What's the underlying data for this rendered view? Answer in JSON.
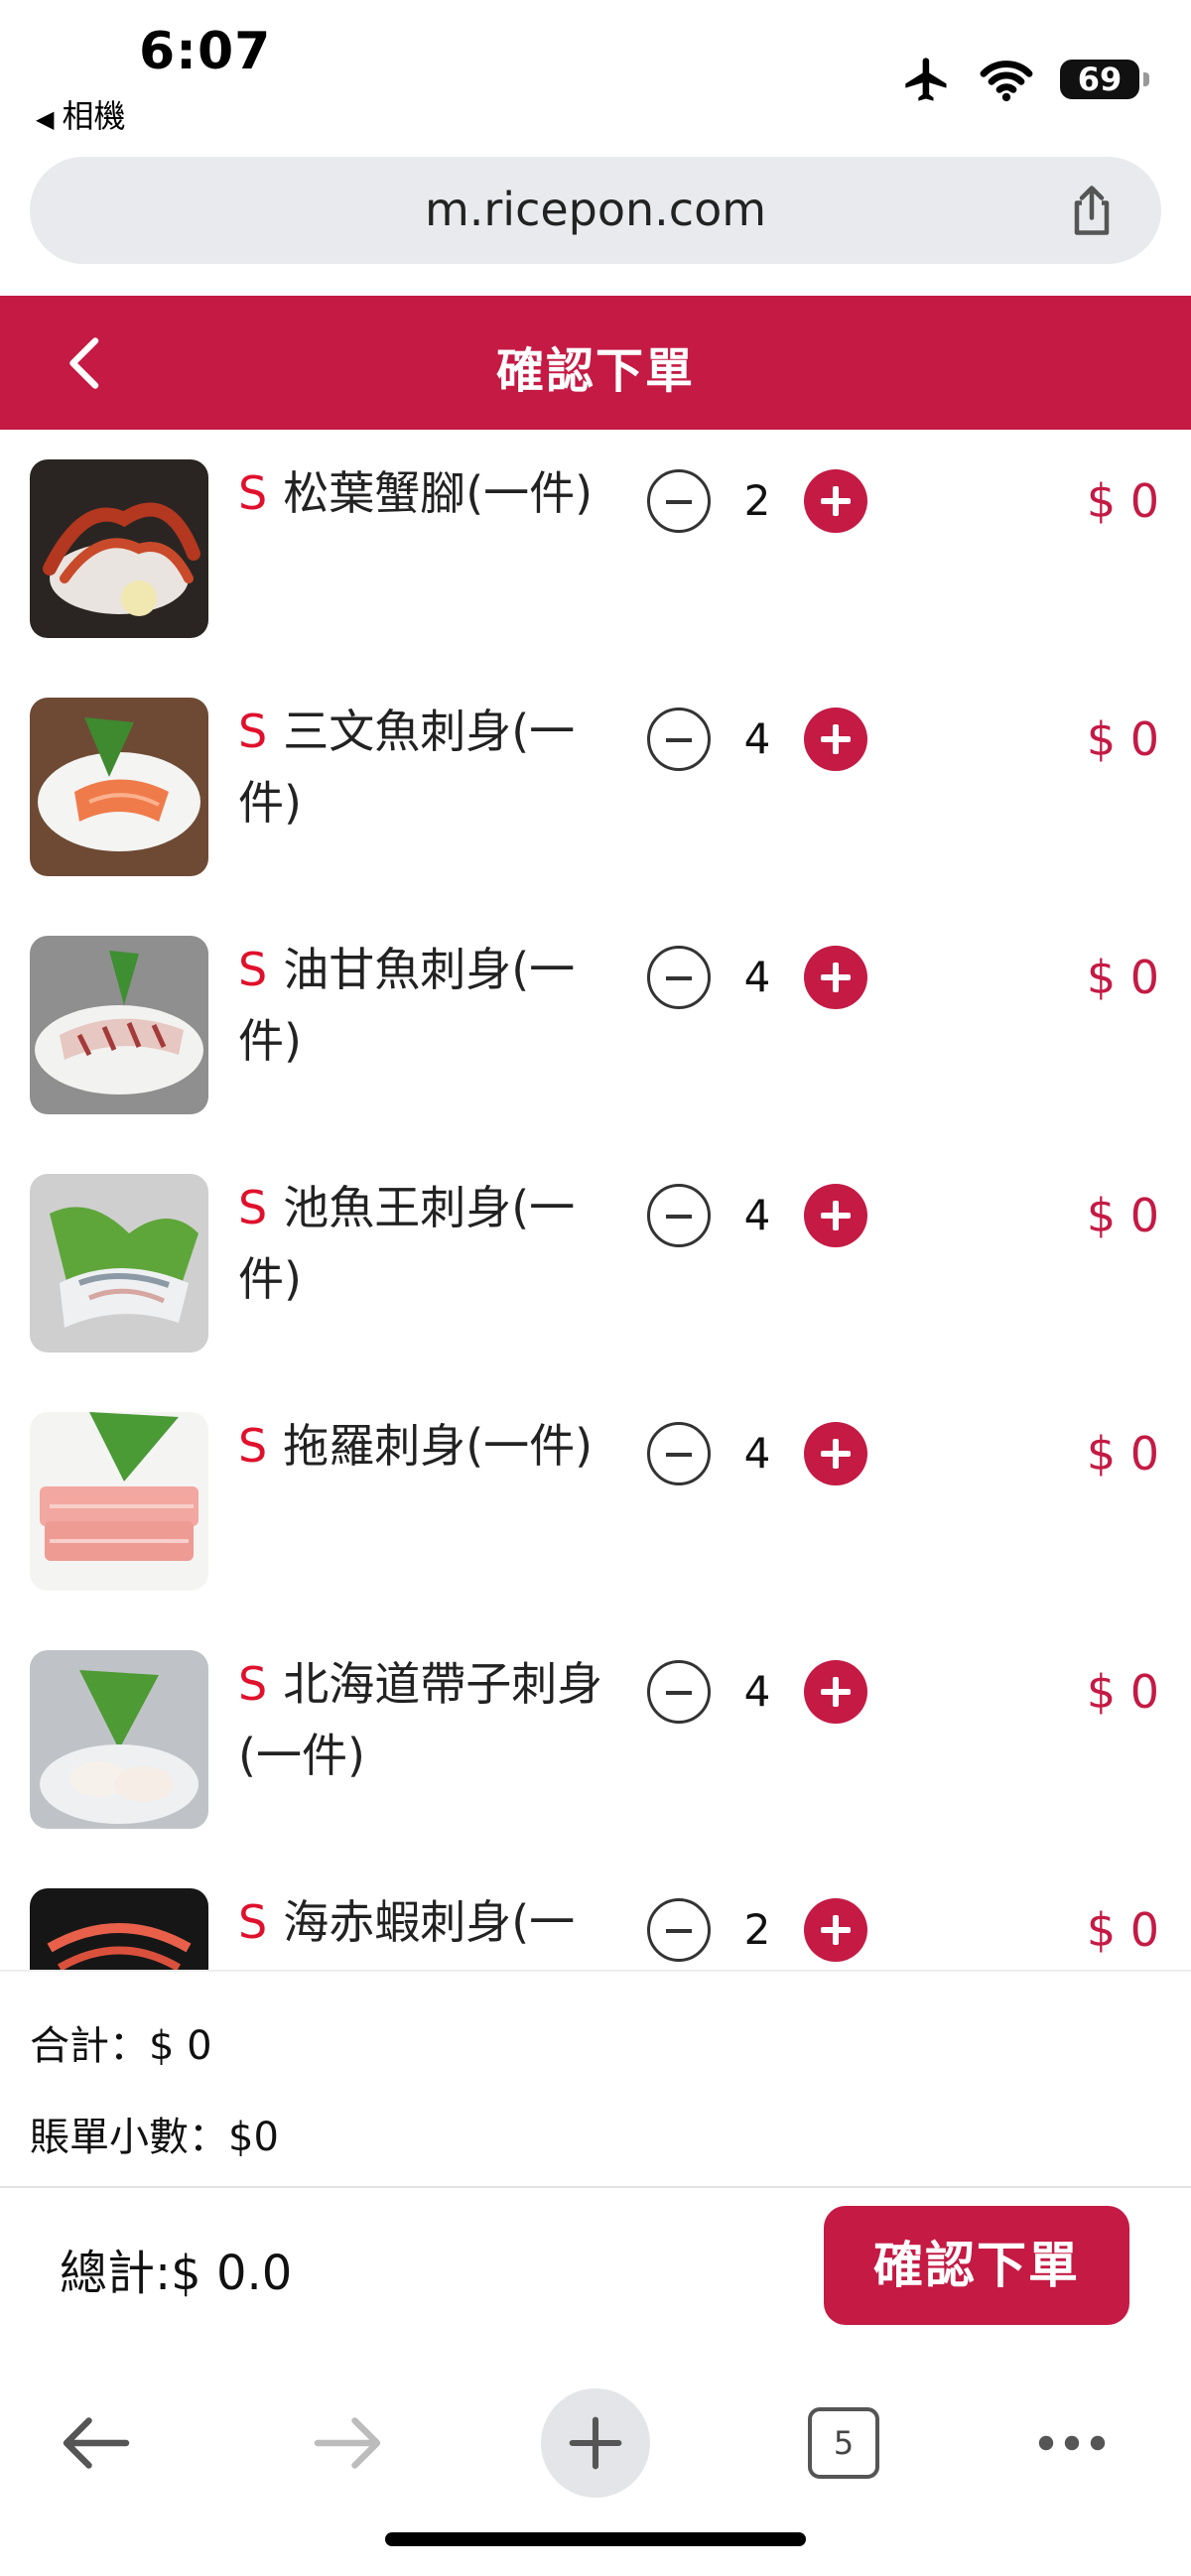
{
  "status_bar": {
    "time": "6:07",
    "back_app": "相機",
    "battery": "69",
    "icons": [
      "airplane-icon",
      "wifi-icon",
      "battery-icon"
    ]
  },
  "browser": {
    "url": "m.ricepon.com",
    "tab_count": "5"
  },
  "header": {
    "title": "確認下單"
  },
  "items": [
    {
      "flag": "S",
      "name": "松葉蟹腳(一件)",
      "qty": "2",
      "price": "$ 0"
    },
    {
      "flag": "S",
      "name": "三文魚刺身(一件)",
      "qty": "4",
      "price": "$ 0"
    },
    {
      "flag": "S",
      "name": "油甘魚刺身(一件)",
      "qty": "4",
      "price": "$ 0"
    },
    {
      "flag": "S",
      "name": "池魚王刺身(一件)",
      "qty": "4",
      "price": "$ 0"
    },
    {
      "flag": "S",
      "name": "拖羅刺身(一件)",
      "qty": "4",
      "price": "$ 0"
    },
    {
      "flag": "S",
      "name": "北海道帶子刺身(一件)",
      "qty": "4",
      "price": "$ 0"
    },
    {
      "flag": "S",
      "name": "海赤蝦刺身(一件)",
      "qty": "2",
      "price": "$ 0"
    }
  ],
  "summary": {
    "subtotal": "合計：$ 0",
    "service_charge": "賬單小數：$0"
  },
  "footer": {
    "grand_total": "總計:$ 0.0",
    "confirm_label": "確認下單"
  },
  "colors": {
    "accent": "#c41a44",
    "flag": "#e0102c"
  }
}
